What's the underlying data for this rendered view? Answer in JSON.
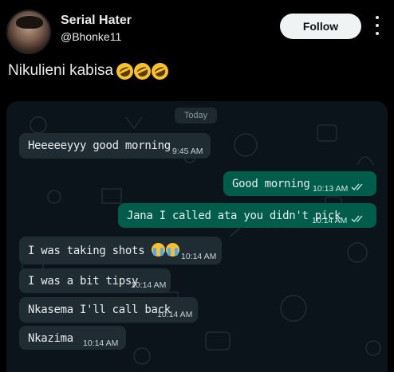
{
  "tweet": {
    "author_name": "Serial Hater",
    "author_handle": "@Bhonke11",
    "follow_label": "Follow",
    "text": "Nikulieni kabisa",
    "text_emojis": [
      "rofl-emoji",
      "rofl-emoji",
      "rofl-emoji"
    ]
  },
  "chat": {
    "date_divider": "Today",
    "messages": [
      {
        "direction": "incoming",
        "text": "Heeeeeyyy good morning",
        "time": "9:45 AM"
      },
      {
        "direction": "outgoing",
        "text": "Good morning",
        "time": "10:13 AM",
        "status": "read-double-tick"
      },
      {
        "direction": "outgoing",
        "text": "Jana I called ata you didn't pick",
        "time": "10:14 AM",
        "status": "read-double-tick"
      },
      {
        "direction": "incoming",
        "text": "I was taking shots",
        "emojis": [
          "loudly-crying-emoji",
          "loudly-crying-emoji"
        ],
        "time": "10:14 AM"
      },
      {
        "direction": "incoming",
        "text": "I was a bit tipsy",
        "time": "10:14 AM"
      },
      {
        "direction": "incoming",
        "text": "Nkasema I'll call back",
        "time": "10:14 AM"
      },
      {
        "direction": "incoming",
        "text": "Nkazima",
        "time": "10:14 AM"
      }
    ]
  },
  "colors": {
    "background": "#000000",
    "chat_background": "#0b141a",
    "incoming_bubble": "#202c33",
    "outgoing_bubble": "#005c4b",
    "follow_button": "#eff3f4"
  }
}
